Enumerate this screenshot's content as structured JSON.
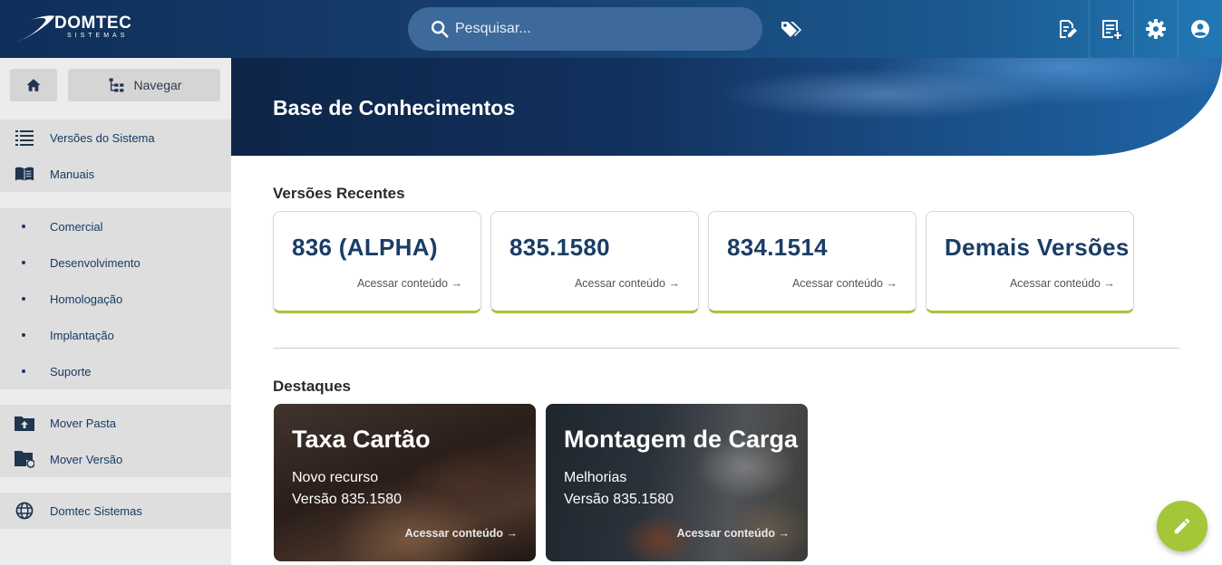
{
  "header": {
    "brand": "DOMTEC",
    "brand_sub": "SISTEMAS",
    "search_placeholder": "Pesquisar...",
    "icons": [
      "search-icon",
      "tags-icon",
      "edit-document-icon",
      "add-document-icon",
      "gear-icon",
      "account-icon"
    ]
  },
  "sidebar": {
    "nav_label": "Navegar",
    "group1": [
      {
        "label": "Versões do Sistema",
        "icon": "list-icon"
      },
      {
        "label": "Manuais",
        "icon": "book-icon"
      }
    ],
    "subitems": [
      "Comercial",
      "Desenvolvimento",
      "Homologação",
      "Implantação",
      "Suporte"
    ],
    "group2": [
      {
        "label": "Mover Pasta",
        "icon": "folder-upload-icon"
      },
      {
        "label": "Mover Versão",
        "icon": "folder-sync-icon"
      }
    ],
    "group3": [
      {
        "label": "Domtec Sistemas",
        "icon": "globe-icon"
      }
    ]
  },
  "hero": {
    "title": "Base de Conhecimentos"
  },
  "recent": {
    "heading": "Versões Recentes",
    "cards": [
      {
        "title": "836 (ALPHA)",
        "link": "Acessar conteúdo →"
      },
      {
        "title": "835.1580",
        "link": "Acessar conteúdo →"
      },
      {
        "title": "834.1514",
        "link": "Acessar conteúdo →"
      },
      {
        "title": "Demais Versões",
        "link": "Acessar conteúdo →"
      }
    ]
  },
  "highlights": {
    "heading": "Destaques",
    "cards": [
      {
        "title": "Taxa Cartão",
        "subtitle": "Novo recurso",
        "version": "Versão 835.1580",
        "link": "Acessar conteúdo →"
      },
      {
        "title": "Montagem de Carga",
        "subtitle": "Melhorias",
        "version": "Versão 835.1580",
        "link": "Acessar conteúdo →"
      }
    ]
  },
  "colors": {
    "header_dark": "#0f2f5a",
    "accent_green": "#a4c639",
    "title_blue": "#1a3d66"
  }
}
